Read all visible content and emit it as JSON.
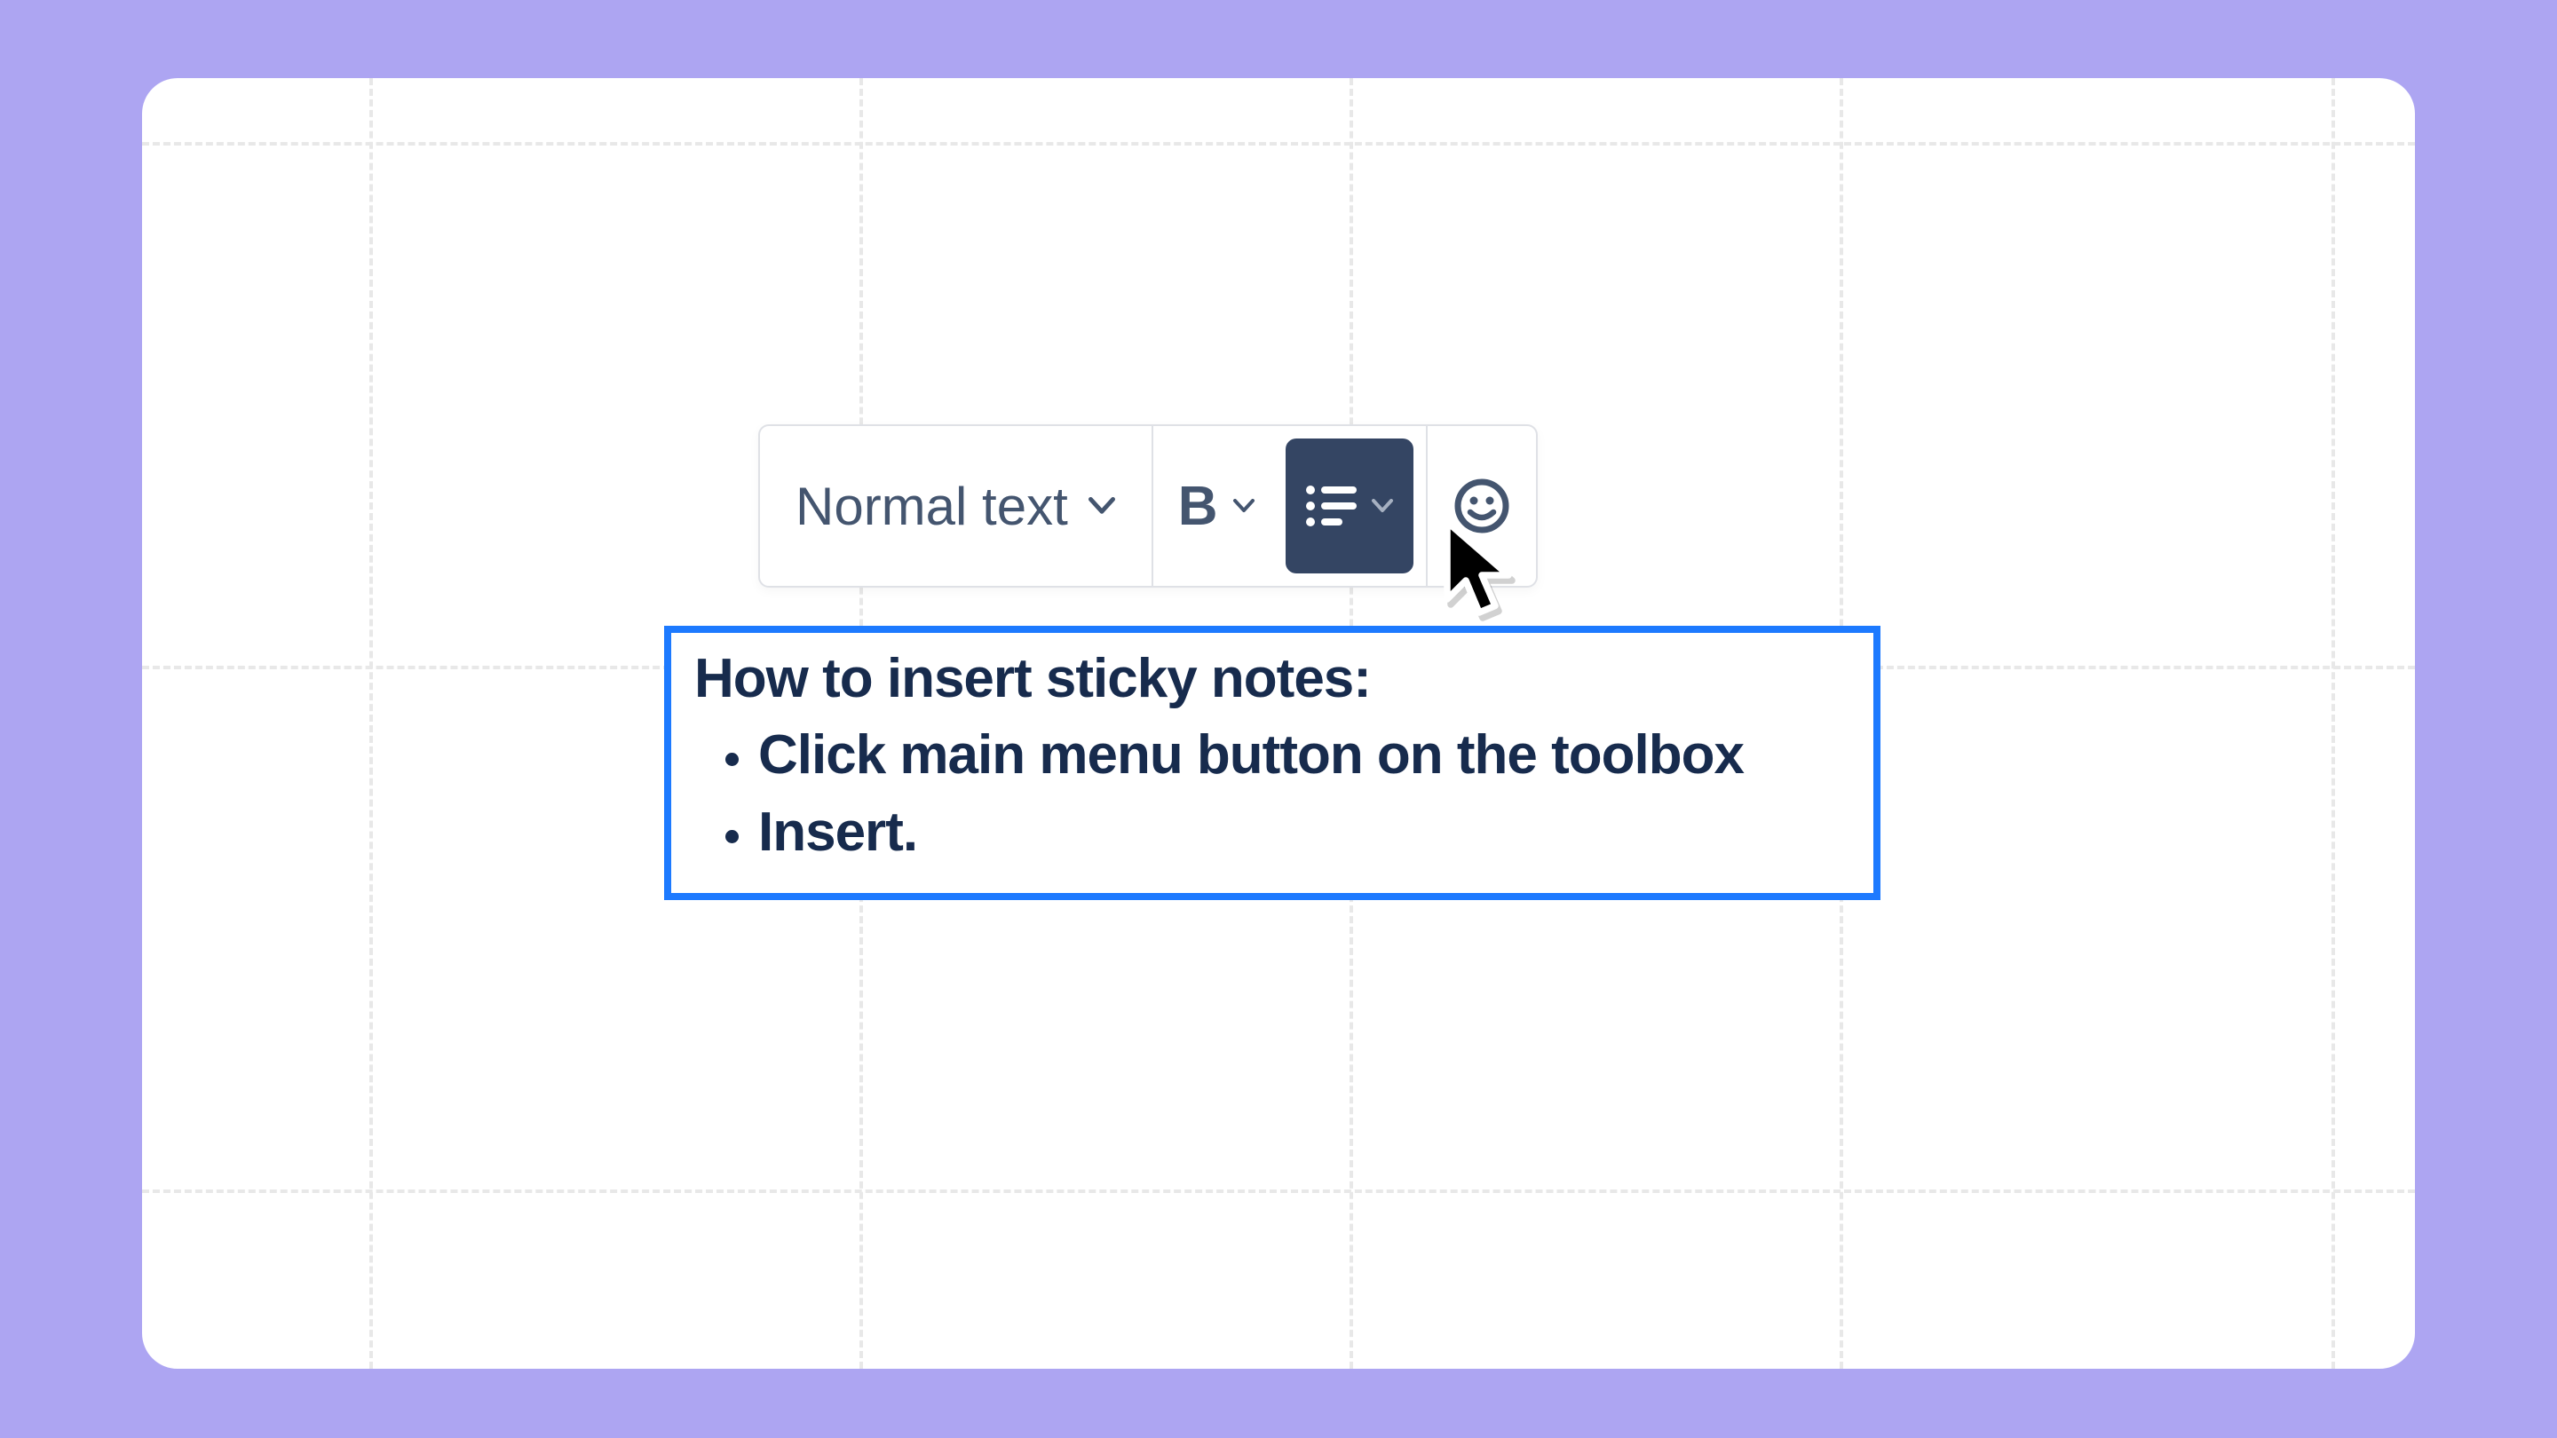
{
  "colors": {
    "background": "#ada5f2",
    "canvas": "#ffffff",
    "toolbar_border": "#dfe1e6",
    "toolbar_text": "#44556f",
    "active_button": "#344563",
    "selection_border": "#1d7aff",
    "text_color": "#172b4d"
  },
  "toolbar": {
    "text_style_label": "Normal text",
    "bold_label": "B",
    "icons": {
      "text_style_chevron": "chevron-down-icon",
      "bold_chevron": "chevron-down-icon",
      "list": "list-icon",
      "list_chevron": "chevron-down-icon",
      "emoji": "smile-icon"
    }
  },
  "text_block": {
    "title": "How to insert sticky notes:",
    "items": [
      "Click main menu button on the toolbox",
      "Insert."
    ]
  },
  "cursor": {
    "name": "cursor-icon"
  }
}
